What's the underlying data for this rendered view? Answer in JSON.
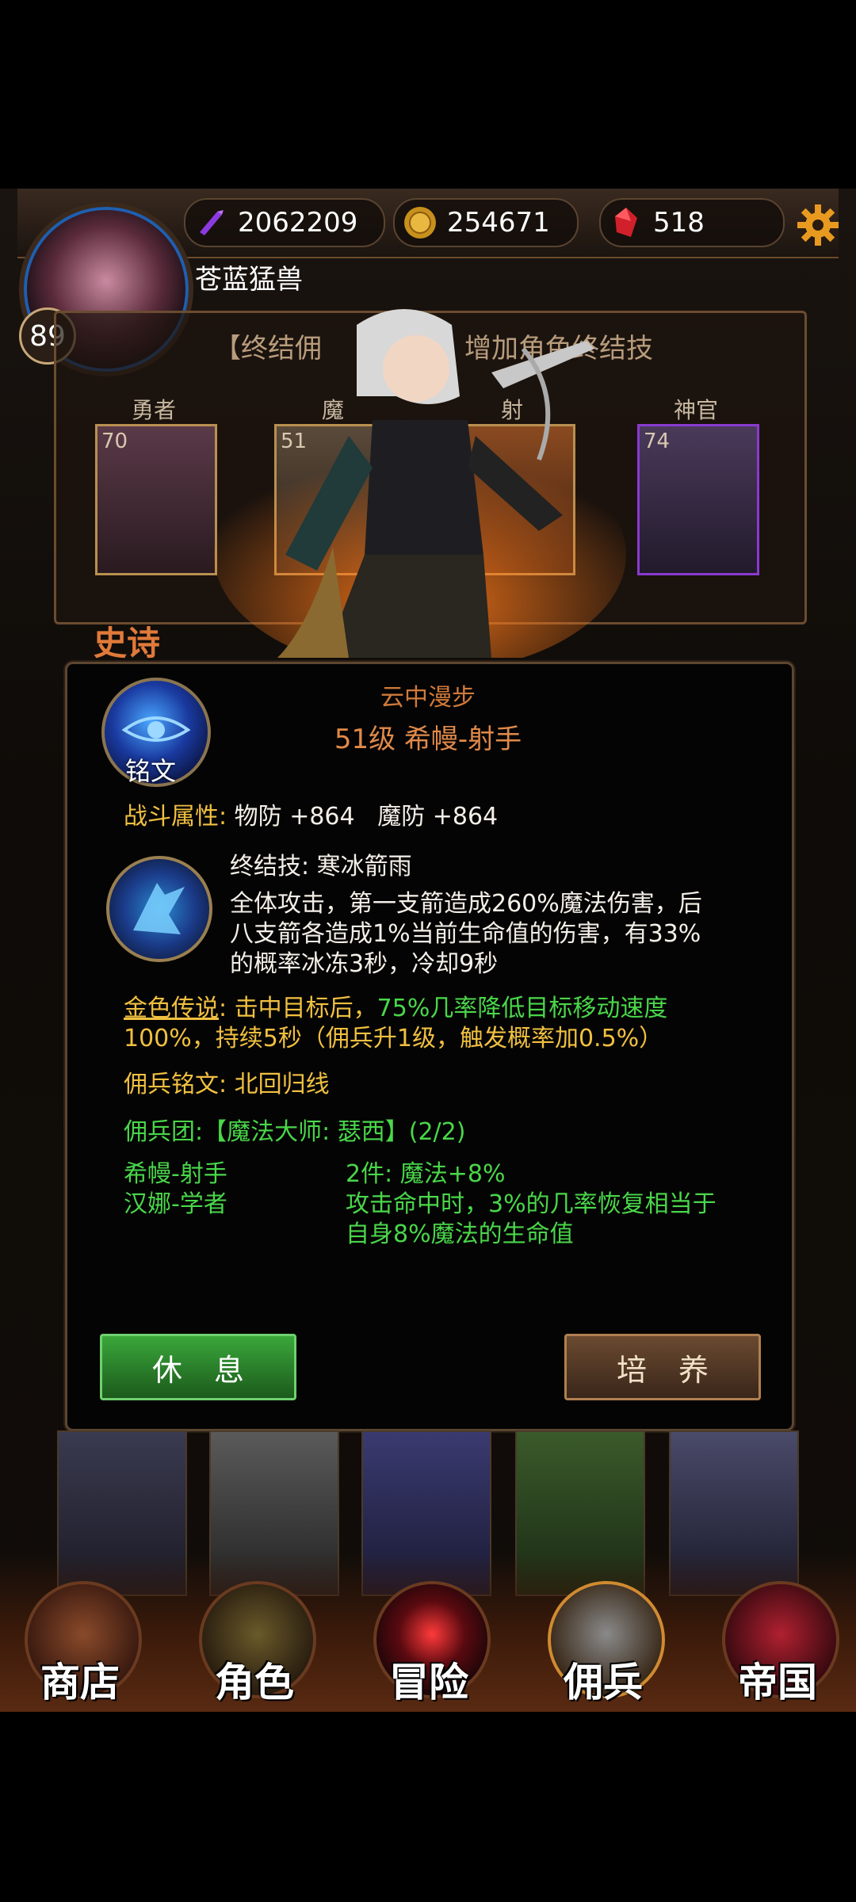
{
  "resources": {
    "gems": "2062209",
    "gold": "254671",
    "crystals": "518"
  },
  "player": {
    "level": "89",
    "name": "苍蓝猛兽"
  },
  "legend_banner": "【终结佣",
  "legend_banner_tail": "增加角色终结技",
  "heroes": [
    {
      "class": "勇者",
      "level": "70"
    },
    {
      "class": "魔",
      "level": "51"
    },
    {
      "class": "射",
      "level": ""
    },
    {
      "class": "神官",
      "level": "74"
    }
  ],
  "rarity_label": "史诗",
  "dialog": {
    "rune_label": "铭文",
    "skill_name": "云中漫步",
    "hero_title": "51级 希幔-射手",
    "combat_label": "战斗属性:",
    "combat_values": "物防 +864   魔防 +864",
    "finisher_title": "终结技: 寒冰箭雨",
    "finisher_desc_1": "全体攻击，第一支箭造成260%魔法伤害，后",
    "finisher_desc_2": "八支箭各造成1%当前生命值的伤害，有33%",
    "finisher_desc_3": "的概率冰冻3秒，冷却9秒",
    "gold_legend_label": "金色传说",
    "gold_legend_text_a": ": 击中目标后，",
    "gold_legend_green": "75%几率降低目标移动速度",
    "gold_legend_text_b": "100%，持续5秒（佣兵升1级，触发概率加0.5%）",
    "rune_line": "佣兵铭文: 北回归线",
    "corps_line": "佣兵团:【魔法大师: 瑟西】(2/2)",
    "members": [
      "希幔-射手",
      "汉娜-学者"
    ],
    "bonus_1": "2件: 魔法+8%",
    "bonus_2a": "攻击命中时，3%的几率恢复相当于",
    "bonus_2b": "自身8%魔法的生命值",
    "rest_button": "休息",
    "train_button": "培养"
  },
  "nav": [
    "商店",
    "角色",
    "冒险",
    "佣兵",
    "帝国"
  ],
  "colors": {
    "accent_orange": "#e07a3a",
    "text_yellow": "#f0c040",
    "text_green": "#49d74a"
  },
  "icons": [
    "gem-icon",
    "gold-coin-icon",
    "crystal-icon",
    "gear-icon"
  ]
}
